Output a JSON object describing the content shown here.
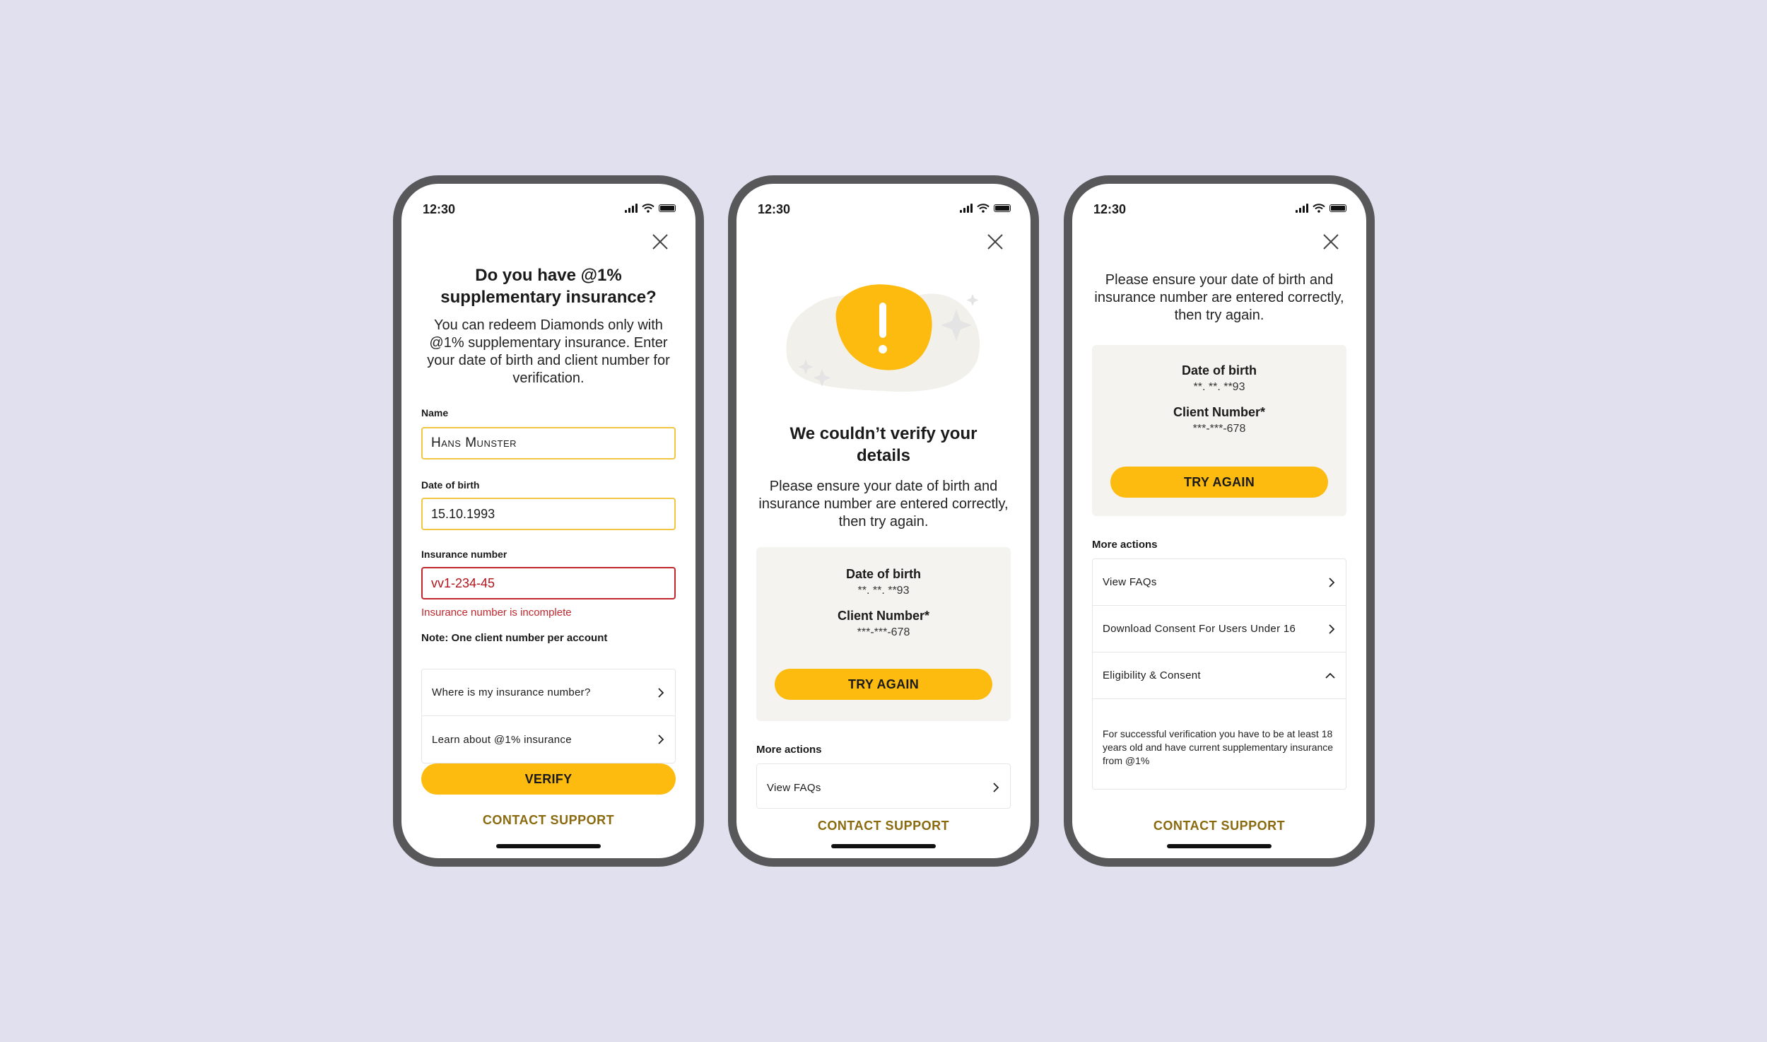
{
  "status": {
    "time": "12:30"
  },
  "screen1": {
    "title": "Do you have @1% supplementary insurance?",
    "description": "You can redeem Diamonds only with @1% supplementary insurance. Enter your date of birth and client number for verification.",
    "name_label": "Name",
    "name_value": "Hans Munster",
    "dob_label": "Date of birth",
    "dob_value": "15.10.1993",
    "insurance_label": "Insurance number",
    "insurance_value": "vv1-234-45",
    "insurance_error": "Insurance number is incomplete",
    "note": "Note: One client number per account",
    "help_items": [
      {
        "label": "Where is my insurance number?"
      },
      {
        "label": "Learn about @1% insurance"
      }
    ],
    "verify_button": "VERIFY",
    "contact_support": "CONTACT SUPPORT"
  },
  "screen2": {
    "title": "We couldn’t verify your details",
    "description": "Please ensure your date of birth and insurance number are entered correctly, then try again.",
    "dob_label": "Date of birth",
    "dob_value": "**. **. **93",
    "client_label": "Client Number*",
    "client_value": "***-***-678",
    "try_again": "TRY AGAIN",
    "more_actions": "More actions",
    "actions": [
      {
        "label": "View FAQs"
      }
    ],
    "contact_support": "CONTACT SUPPORT"
  },
  "screen3": {
    "description": "Please ensure your date of birth and insurance number are entered correctly, then try again.",
    "dob_label": "Date of birth",
    "dob_value": "**. **. **93",
    "client_label": "Client Number*",
    "client_value": "***-***-678",
    "try_again": "TRY AGAIN",
    "more_actions": "More actions",
    "actions": [
      {
        "label": "View FAQs"
      },
      {
        "label": "Download Consent For Users Under 16"
      },
      {
        "label": "Eligibility & Consent"
      }
    ],
    "eligibility_text": "For successful verification you have to be at least 18 years old and have current supplementary insurance from @1%",
    "contact_support": "CONTACT SUPPORT"
  },
  "colors": {
    "background": "#E1E0EE",
    "accent": "#FDBB0F",
    "link": "#8A6A0F",
    "error": "#C0272D",
    "phone_frame": "#58585A"
  }
}
